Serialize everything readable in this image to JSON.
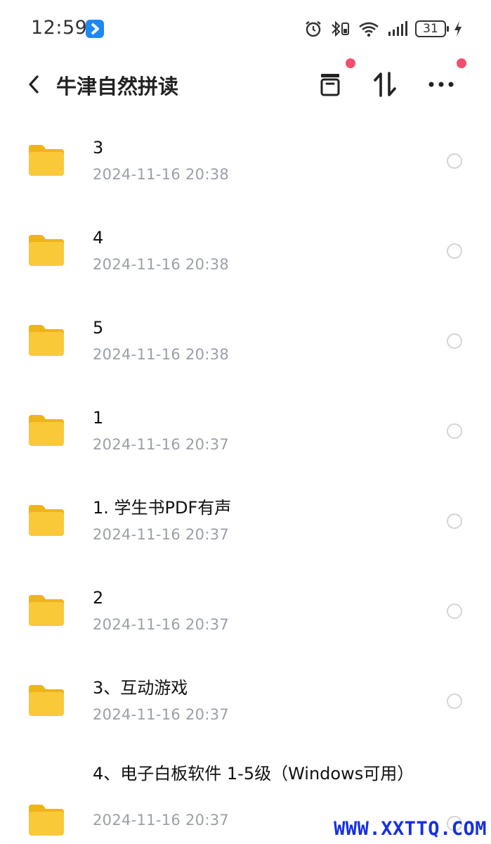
{
  "status_bar": {
    "time": "12:59",
    "battery": "31",
    "icons": [
      "app-icon",
      "alarm-icon",
      "bluetooth-icon",
      "wifi-icon",
      "signal-icon",
      "battery-icon",
      "charging-icon"
    ]
  },
  "header": {
    "title": "牛津自然拼读",
    "back_icon": "chevron-left-icon",
    "actions": [
      "archive-icon",
      "sort-icon",
      "more-icon"
    ],
    "badge_color": "#f0506e"
  },
  "files": [
    {
      "name": "3",
      "date": "2024-11-16  20:38"
    },
    {
      "name": "4",
      "date": "2024-11-16  20:38"
    },
    {
      "name": "5",
      "date": "2024-11-16  20:38"
    },
    {
      "name": "1",
      "date": "2024-11-16  20:37"
    },
    {
      "name": "1. 学生书PDF有声",
      "date": "2024-11-16  20:37"
    },
    {
      "name": "2",
      "date": "2024-11-16  20:37"
    },
    {
      "name": "3、互动游戏",
      "date": "2024-11-16  20:37"
    },
    {
      "name": "4、电子白板软件 1-5级（Windows可用）",
      "date": "2024-11-16  20:37"
    }
  ],
  "folder_color": "#f7c52c",
  "watermark": "WWW.XXTTQ.COM"
}
